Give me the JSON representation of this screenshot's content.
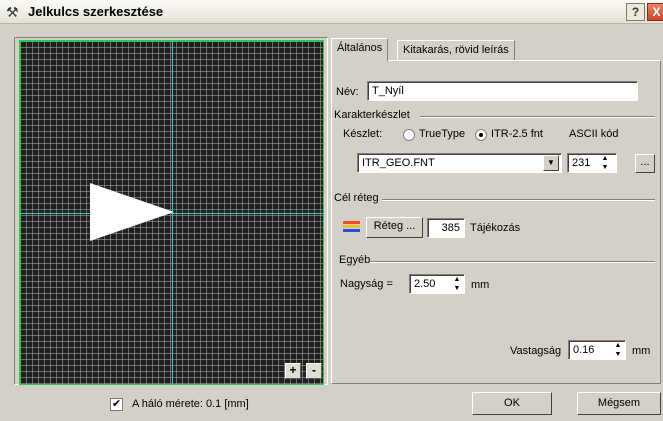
{
  "window": {
    "title": "Jelkulcs szerkesztése",
    "help_label": "?",
    "close_label": "X"
  },
  "canvas": {
    "zoom_in_label": "+",
    "zoom_out_label": "-",
    "grid_checked": true,
    "grid_label": "A háló mérete: 0.1 [mm]"
  },
  "tabs": [
    {
      "label": "Általános"
    },
    {
      "label": "Kitakarás, rövid leírás"
    }
  ],
  "general": {
    "name_label": "Név:",
    "name_value": "T_Nyíl",
    "charset_group": "Karakterkészlet",
    "set_label": "Készlet:",
    "radio_truetype": "TrueType",
    "radio_itr": "ITR-2.5 fnt",
    "ascii_label": "ASCII kód",
    "font_value": "ITR_GEO.FNT",
    "ascii_value": "231",
    "browse_label": "...",
    "target_group": "Cél réteg",
    "layer_button": "Réteg ...",
    "layer_value": "385",
    "layer_name": "Tájékozás",
    "other_group": "Egyéb",
    "size_label": "Nagyság =",
    "size_value": "2.50",
    "size_unit": "mm",
    "thickness_label": "Vastagság",
    "thickness_value": "0.16",
    "thickness_unit": "mm"
  },
  "footer": {
    "ok_label": "OK",
    "cancel_label": "Mégsem"
  }
}
